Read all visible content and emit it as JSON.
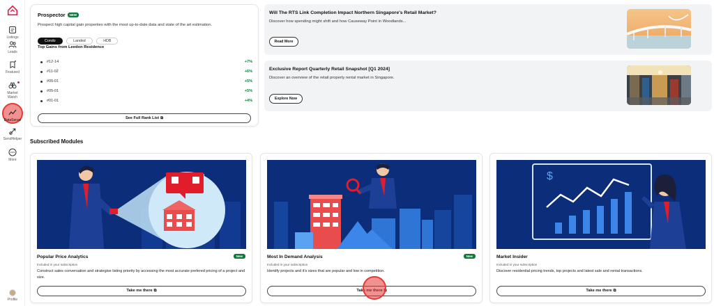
{
  "sidebar": {
    "items": [
      {
        "label": "Listings",
        "icon": "listings-icon"
      },
      {
        "label": "Leads",
        "icon": "leads-icon"
      },
      {
        "label": "Featured",
        "icon": "featured-icon"
      },
      {
        "label": "Market Watch",
        "icon": "binoculars-icon"
      },
      {
        "label": "DataSense",
        "icon": "chart-line-icon"
      },
      {
        "label": "SendHelper",
        "icon": "send-icon"
      },
      {
        "label": "More",
        "icon": "more-icon"
      }
    ],
    "profile_label": "Profile"
  },
  "prospector": {
    "title": "Prospector",
    "badge": "NEW",
    "description": "Prospect high capital gain properties with the most up-to-date data and state of the art estimation.",
    "tabs": [
      "Condo",
      "Landed",
      "HDB"
    ],
    "active_tab": "Condo",
    "subtitle": "Top Gains from Leedon Residence",
    "gains": [
      {
        "unit": "#12-14",
        "value": "+7%"
      },
      {
        "unit": "#11-02",
        "value": "+6%"
      },
      {
        "unit": "#05-01",
        "value": "+5%"
      },
      {
        "unit": "#05-01",
        "value": "+5%"
      },
      {
        "unit": "#01-01",
        "value": "+4%"
      }
    ],
    "button": "See Full Rank List"
  },
  "articles": [
    {
      "title": "Will The RTS Link Completion Impact Northern Singapore's Retail Market?",
      "description": "Discover how spending might shift and how Causeway Point in Woodlands...",
      "button": "Read More"
    },
    {
      "title": "Exclusive Report Quarterly Retail Snapshot [Q1 2024]",
      "description": "Discover an overview of the retail property rental market in Singapore.",
      "button": "Explore Now"
    }
  ],
  "section_title": "Subscribed Modules",
  "modules": [
    {
      "title": "Popular Price Analytics",
      "badge": "New",
      "included": "Included in your subscription",
      "description": "Construct sales conversation and strategise listing priority by accessing the most accurate prefered pricing of a project and size.",
      "button": "Take me there"
    },
    {
      "title": "Most In Demand Analysis",
      "badge": "New",
      "included": "Included in your subscription",
      "description": "Identify projects and it's sizes that are popular and low in competition.",
      "button": "Take me there"
    },
    {
      "title": "Market Insider",
      "badge": "",
      "included": "Included in your subscription",
      "description": "Discover residential pricing trends, top projects and latest sale and rental transactions.",
      "button": "Take me there"
    }
  ],
  "colors": {
    "accent_green": "#0f7a3e",
    "illustration_navy": "#0c2d7a",
    "highlight_red": "#e53935"
  }
}
